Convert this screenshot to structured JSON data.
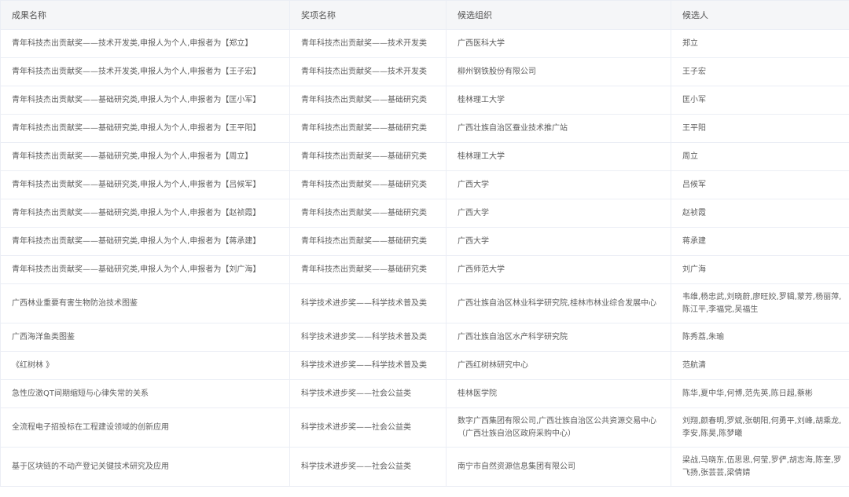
{
  "table": {
    "headers": [
      "成果名称",
      "奖项名称",
      "候选组织",
      "候选人"
    ],
    "rows": [
      [
        "青年科技杰出贡献奖——技术开发类,申报人为个人,申报者为【郑立】",
        "青年科技杰出贡献奖——技术开发类",
        "广西医科大学",
        "郑立"
      ],
      [
        "青年科技杰出贡献奖——技术开发类,申报人为个人,申报者为【王子宏】",
        "青年科技杰出贡献奖——技术开发类",
        "柳州钢铁股份有限公司",
        "王子宏"
      ],
      [
        "青年科技杰出贡献奖——基础研究类,申报人为个人,申报者为【匡小军】",
        "青年科技杰出贡献奖——基础研究类",
        "桂林理工大学",
        "匡小军"
      ],
      [
        "青年科技杰出贡献奖——基础研究类,申报人为个人,申报者为【王平阳】",
        "青年科技杰出贡献奖——基础研究类",
        "广西壮族自治区蚕业技术推广站",
        "王平阳"
      ],
      [
        "青年科技杰出贡献奖——基础研究类,申报人为个人,申报者为【周立】",
        "青年科技杰出贡献奖——基础研究类",
        "桂林理工大学",
        "周立"
      ],
      [
        "青年科技杰出贡献奖——基础研究类,申报人为个人,申报者为【吕候军】",
        "青年科技杰出贡献奖——基础研究类",
        "广西大学",
        "吕候军"
      ],
      [
        "青年科技杰出贡献奖——基础研究类,申报人为个人,申报者为【赵祯霞】",
        "青年科技杰出贡献奖——基础研究类",
        "广西大学",
        "赵祯霞"
      ],
      [
        "青年科技杰出贡献奖——基础研究类,申报人为个人,申报者为【蒋承建】",
        "青年科技杰出贡献奖——基础研究类",
        "广西大学",
        "蒋承建"
      ],
      [
        "青年科技杰出贡献奖——基础研究类,申报人为个人,申报者为【刘广海】",
        "青年科技杰出贡献奖——基础研究类",
        "广西师范大学",
        "刘广海"
      ],
      [
        "广西林业重要有害生物防治技术图鉴",
        "科学技术进步奖——科学技术普及类",
        "广西壮族自治区林业科学研究院,桂林市林业综合发展中心",
        "韦维,杨忠武,刘晓蔚,廖旺姣,罗辑,蒙芳,杨丽萍,陈江平,李福党,吴福生"
      ],
      [
        "广西海洋鱼类图鉴",
        "科学技术进步奖——科学技术普及类",
        "广西壮族自治区水产科学研究院",
        "陈秀荔,朱瑜"
      ],
      [
        "《红树林 》",
        "科学技术进步奖——科学技术普及类",
        "广西红树林研究中心",
        "范航清"
      ],
      [
        "急性应激QT间期缩短与心律失常的关系",
        "科学技术进步奖——社会公益类",
        "桂林医学院",
        "陈华,夏中华,何博,范先英,陈日超,蔡彬"
      ],
      [
        "全流程电子招投标在工程建设领域的创新应用",
        "科学技术进步奖——社会公益类",
        "数字广西集团有限公司,广西壮族自治区公共资源交易中心（广西壮族自治区政府采购中心）",
        "刘翔,颜春明,罗斌,张朝阳,何勇平,刘峰,胡乘龙,李安,陈昊,陈梦曦"
      ],
      [
        "基于区块链的不动产登记关键技术研究及应用",
        "科学技术进步奖——社会公益类",
        "南宁市自然资源信息集团有限公司",
        "梁战,马晓东,伍思思,何莹,罗俨,胡志海,陈奎,罗飞扬,张芸芸,梁倩婧"
      ]
    ],
    "colors": {
      "header_bg": "#f5f6f8",
      "border": "#ebeef5",
      "text": "#5e5e5e"
    }
  }
}
